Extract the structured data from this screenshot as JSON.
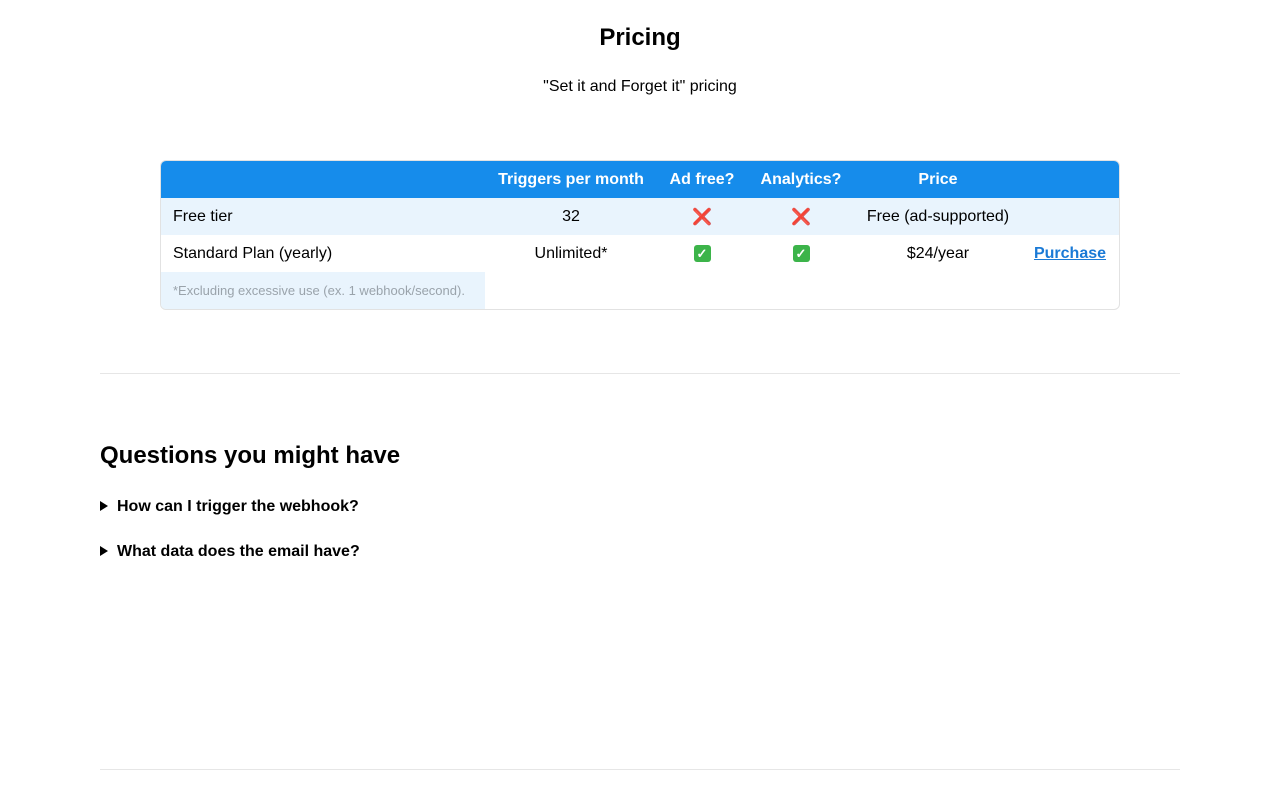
{
  "header": {
    "title": "Pricing",
    "subtitle": "\"Set it and Forget it\" pricing"
  },
  "pricing_table": {
    "columns": [
      "",
      "Triggers per month",
      "Ad free?",
      "Analytics?",
      "Price",
      ""
    ],
    "rows": [
      {
        "plan": "Free tier",
        "triggers": "32",
        "ad_free": "❌",
        "analytics": "❌",
        "price": "Free (ad-supported)",
        "action": ""
      },
      {
        "plan": "Standard Plan (yearly)",
        "triggers": "Unlimited*",
        "ad_free": "✓",
        "analytics": "✓",
        "price": "$24/year",
        "action": "Purchase"
      }
    ],
    "footnote": "*Excluding excessive use (ex. 1 webhook/second)."
  },
  "faq": {
    "heading": "Questions you might have",
    "items": [
      "How can I trigger the webhook?",
      "What data does the email have?"
    ]
  },
  "colors": {
    "header_bg": "#168ceb",
    "row_highlight": "#e9f4fd",
    "link": "#1a7ad6",
    "cross": "#e2282a",
    "check_bg": "#3cb44a"
  }
}
